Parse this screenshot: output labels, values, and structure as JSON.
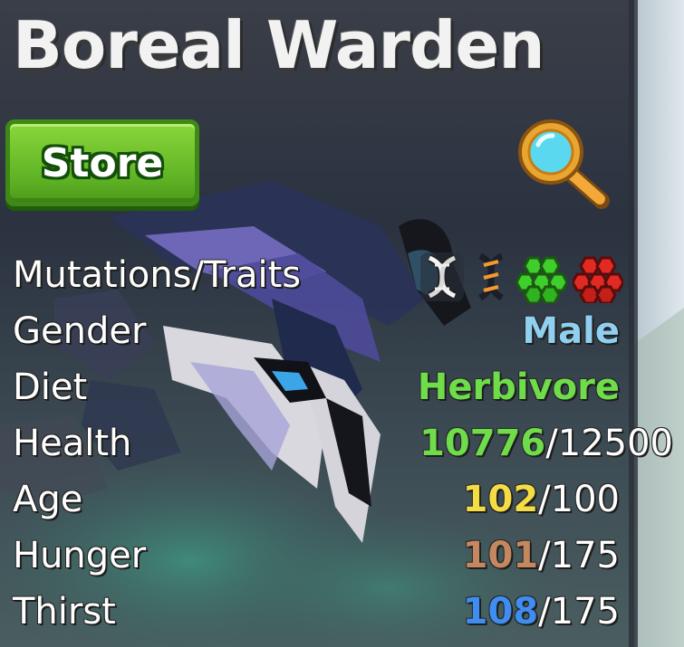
{
  "title": "Boreal Warden",
  "store_button": {
    "label": "Store"
  },
  "stats": {
    "mutations": {
      "label": "Mutations/Traits",
      "icons": [
        "dna-white-icon",
        "dna-orange-icon",
        "green-cells-icon",
        "red-cells-icon"
      ]
    },
    "gender": {
      "label": "Gender",
      "value": "Male",
      "color": "#8fd0f0"
    },
    "diet": {
      "label": "Diet",
      "value": "Herbivore",
      "color": "#6fdd4a"
    },
    "health": {
      "label": "Health",
      "current": "10776",
      "sep": "/",
      "max": "12500",
      "color": "#6fdd4a"
    },
    "age": {
      "label": "Age",
      "current": "102",
      "sep": "/",
      "max": "100",
      "color": "#f4dc45"
    },
    "hunger": {
      "label": "Hunger",
      "current": "101",
      "sep": "/",
      "max": "175",
      "color": "#c4875f"
    },
    "thirst": {
      "label": "Thirst",
      "current": "108",
      "sep": "/",
      "max": "175",
      "color": "#3f8df0"
    }
  },
  "colors": {
    "store": "#5fb324",
    "title": "#f2f2f2"
  }
}
